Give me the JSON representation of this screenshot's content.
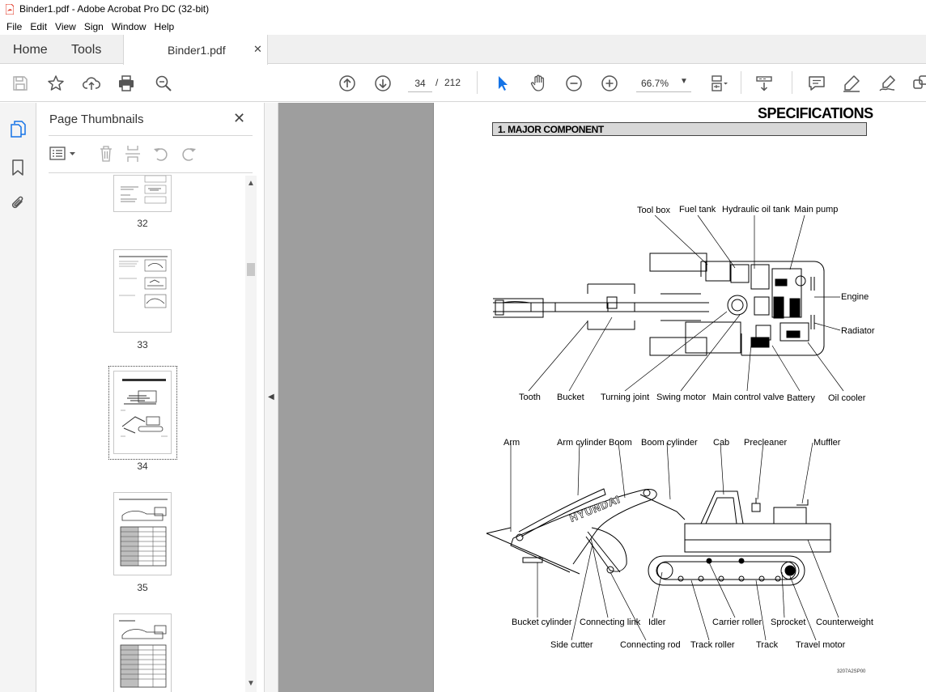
{
  "window": {
    "title": "Binder1.pdf - Adobe Acrobat Pro DC (32-bit)"
  },
  "menu": [
    "File",
    "Edit",
    "View",
    "Sign",
    "Window",
    "Help"
  ],
  "tabs": {
    "home": "Home",
    "tools": "Tools",
    "document": "Binder1.pdf"
  },
  "toolbar": {
    "page_current": "34",
    "page_separator": "/",
    "page_total": "212",
    "zoom": "66.7%"
  },
  "thumbnails": {
    "header": "Page Thumbnails",
    "items": [
      {
        "label": "32"
      },
      {
        "label": "33"
      },
      {
        "label": "34",
        "selected": true
      },
      {
        "label": "35"
      }
    ]
  },
  "document": {
    "title": "SPECIFICATIONS",
    "section": "1. MAJOR COMPONENT",
    "top_view_labels": {
      "tool_box": "Tool box",
      "fuel_tank": "Fuel tank",
      "hydraulic_oil_tank": "Hydraulic oil tank",
      "main_pump": "Main pump",
      "engine": "Engine",
      "radiator": "Radiator",
      "tooth": "Tooth",
      "bucket": "Bucket",
      "turning_joint": "Turning joint",
      "swing_motor": "Swing motor",
      "main_control_valve": "Main control valve",
      "battery": "Battery",
      "oil_cooler": "Oil cooler"
    },
    "side_view_labels": {
      "arm": "Arm",
      "arm_cylinder": "Arm cylinder",
      "boom": "Boom",
      "boom_cylinder": "Boom cylinder",
      "cab": "Cab",
      "precleaner": "Precleaner",
      "muffler": "Muffler",
      "bucket_cylinder": "Bucket cylinder",
      "connecting_link": "Connecting link",
      "idler": "Idler",
      "carrier_roller": "Carrier roller",
      "sprocket": "Sprocket",
      "counterweight": "Counterweight",
      "side_cutter": "Side cutter",
      "connecting_rod": "Connecting rod",
      "track_roller": "Track roller",
      "track": "Track",
      "travel_motor": "Travel motor"
    },
    "brand_text": "HYUNDAI",
    "figure_code": "3207A2SP00"
  },
  "colors": {
    "accent_blue": "#1473e6",
    "pdf_red": "#e0301e",
    "canvas_gray": "#9e9e9e"
  }
}
